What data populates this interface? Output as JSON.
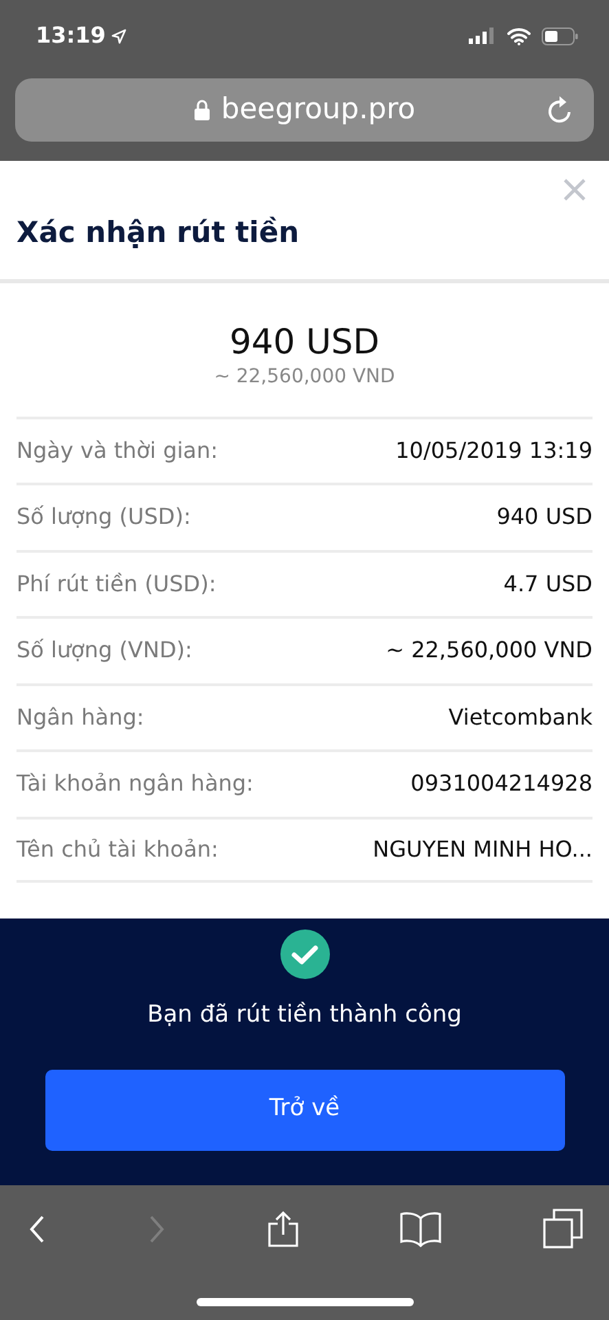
{
  "status_bar": {
    "time": "13:19"
  },
  "address_bar": {
    "url": "beegroup.pro"
  },
  "modal": {
    "title": "Xác nhận rút tiền",
    "amount": "940 USD",
    "amount_converted": "~ 22,560,000 VND",
    "rows": [
      {
        "label": "Ngày và thời gian:",
        "value": "10/05/2019 13:19"
      },
      {
        "label": "Số lượng (USD):",
        "value": "940 USD"
      },
      {
        "label": "Phí rút tiền (USD):",
        "value": "4.7 USD"
      },
      {
        "label": "Số lượng (VND):",
        "value": "~ 22,560,000 VND"
      },
      {
        "label": "Ngân hàng:",
        "value": "Vietcombank"
      },
      {
        "label": "Tài khoản ngân hàng:",
        "value": "0931004214928"
      },
      {
        "label": "Tên chủ tài khoản:",
        "value": "NGUYEN MINH HO..."
      }
    ]
  },
  "success": {
    "message": "Bạn đã rút tiền thành công",
    "button": "Trở về"
  },
  "toolbar": [
    {
      "kind": "back",
      "disabled": false
    },
    {
      "kind": "forward",
      "disabled": true
    },
    {
      "kind": "share",
      "disabled": false
    },
    {
      "kind": "bookmarks",
      "disabled": false
    },
    {
      "kind": "tabs",
      "disabled": false
    }
  ]
}
